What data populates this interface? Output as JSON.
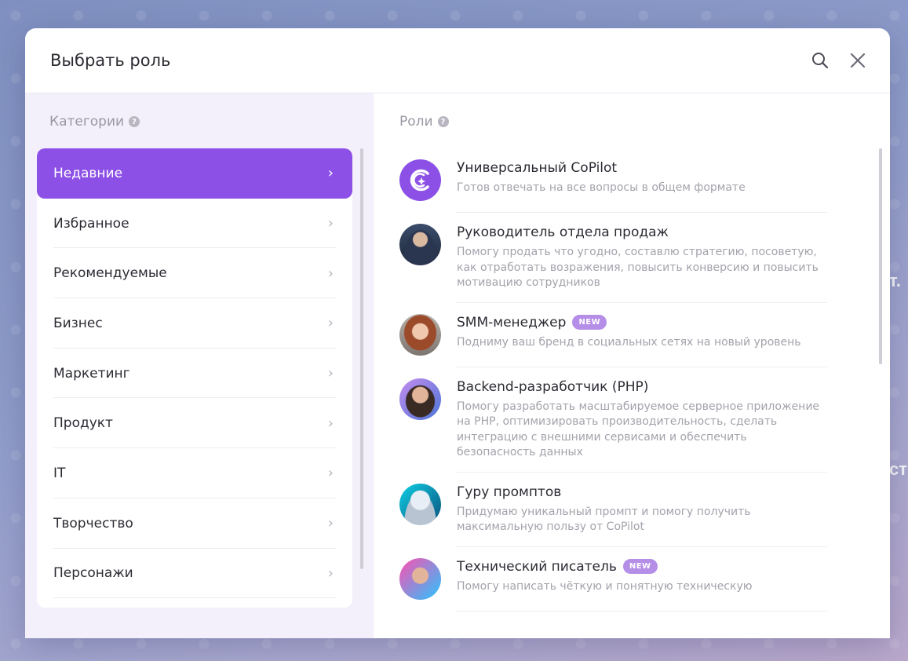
{
  "modal": {
    "title": "Выбрать роль",
    "search_icon": "search-icon",
    "close_icon": "close-icon"
  },
  "categories": {
    "label": "Категории",
    "items": [
      {
        "label": "Недавние",
        "active": true
      },
      {
        "label": "Избранное"
      },
      {
        "label": "Рекомендуемые"
      },
      {
        "label": "Бизнес"
      },
      {
        "label": "Маркетинг"
      },
      {
        "label": "Продукт"
      },
      {
        "label": "IT"
      },
      {
        "label": "Творчество"
      },
      {
        "label": "Персонажи"
      }
    ]
  },
  "roles": {
    "label": "Роли",
    "items": [
      {
        "name": "Универсальный CoPilot",
        "desc": "Готов отвечать на все вопросы в общем формате",
        "badge": ""
      },
      {
        "name": "Руководитель отдела продаж",
        "desc": "Помогу продать что угодно, составлю стратегию, посоветую, как отработать возражения, повысить конверсию и повысить мотивацию сотрудников",
        "badge": ""
      },
      {
        "name": "SMM-менеджер",
        "desc": "Подниму ваш бренд в социальных сетях на новый уровень",
        "badge": "NEW"
      },
      {
        "name": "Backend-разработчик (PHP)",
        "desc": "Помогу разработать масштабируемое серверное приложение на PHP, оптимизировать производительность, сделать интеграцию с внешними сервисами и обеспечить безопасность данных",
        "badge": ""
      },
      {
        "name": "Гуру промптов",
        "desc": "Придумаю уникальный промпт и помогу получить максимальную пользу от CoPilot",
        "badge": ""
      },
      {
        "name": "Технический писатель",
        "desc": "Помогу написать чёткую и понятную техническую",
        "badge": "NEW"
      }
    ]
  },
  "colors": {
    "accent": "#8c50e6",
    "badge": "#b58ee8"
  }
}
